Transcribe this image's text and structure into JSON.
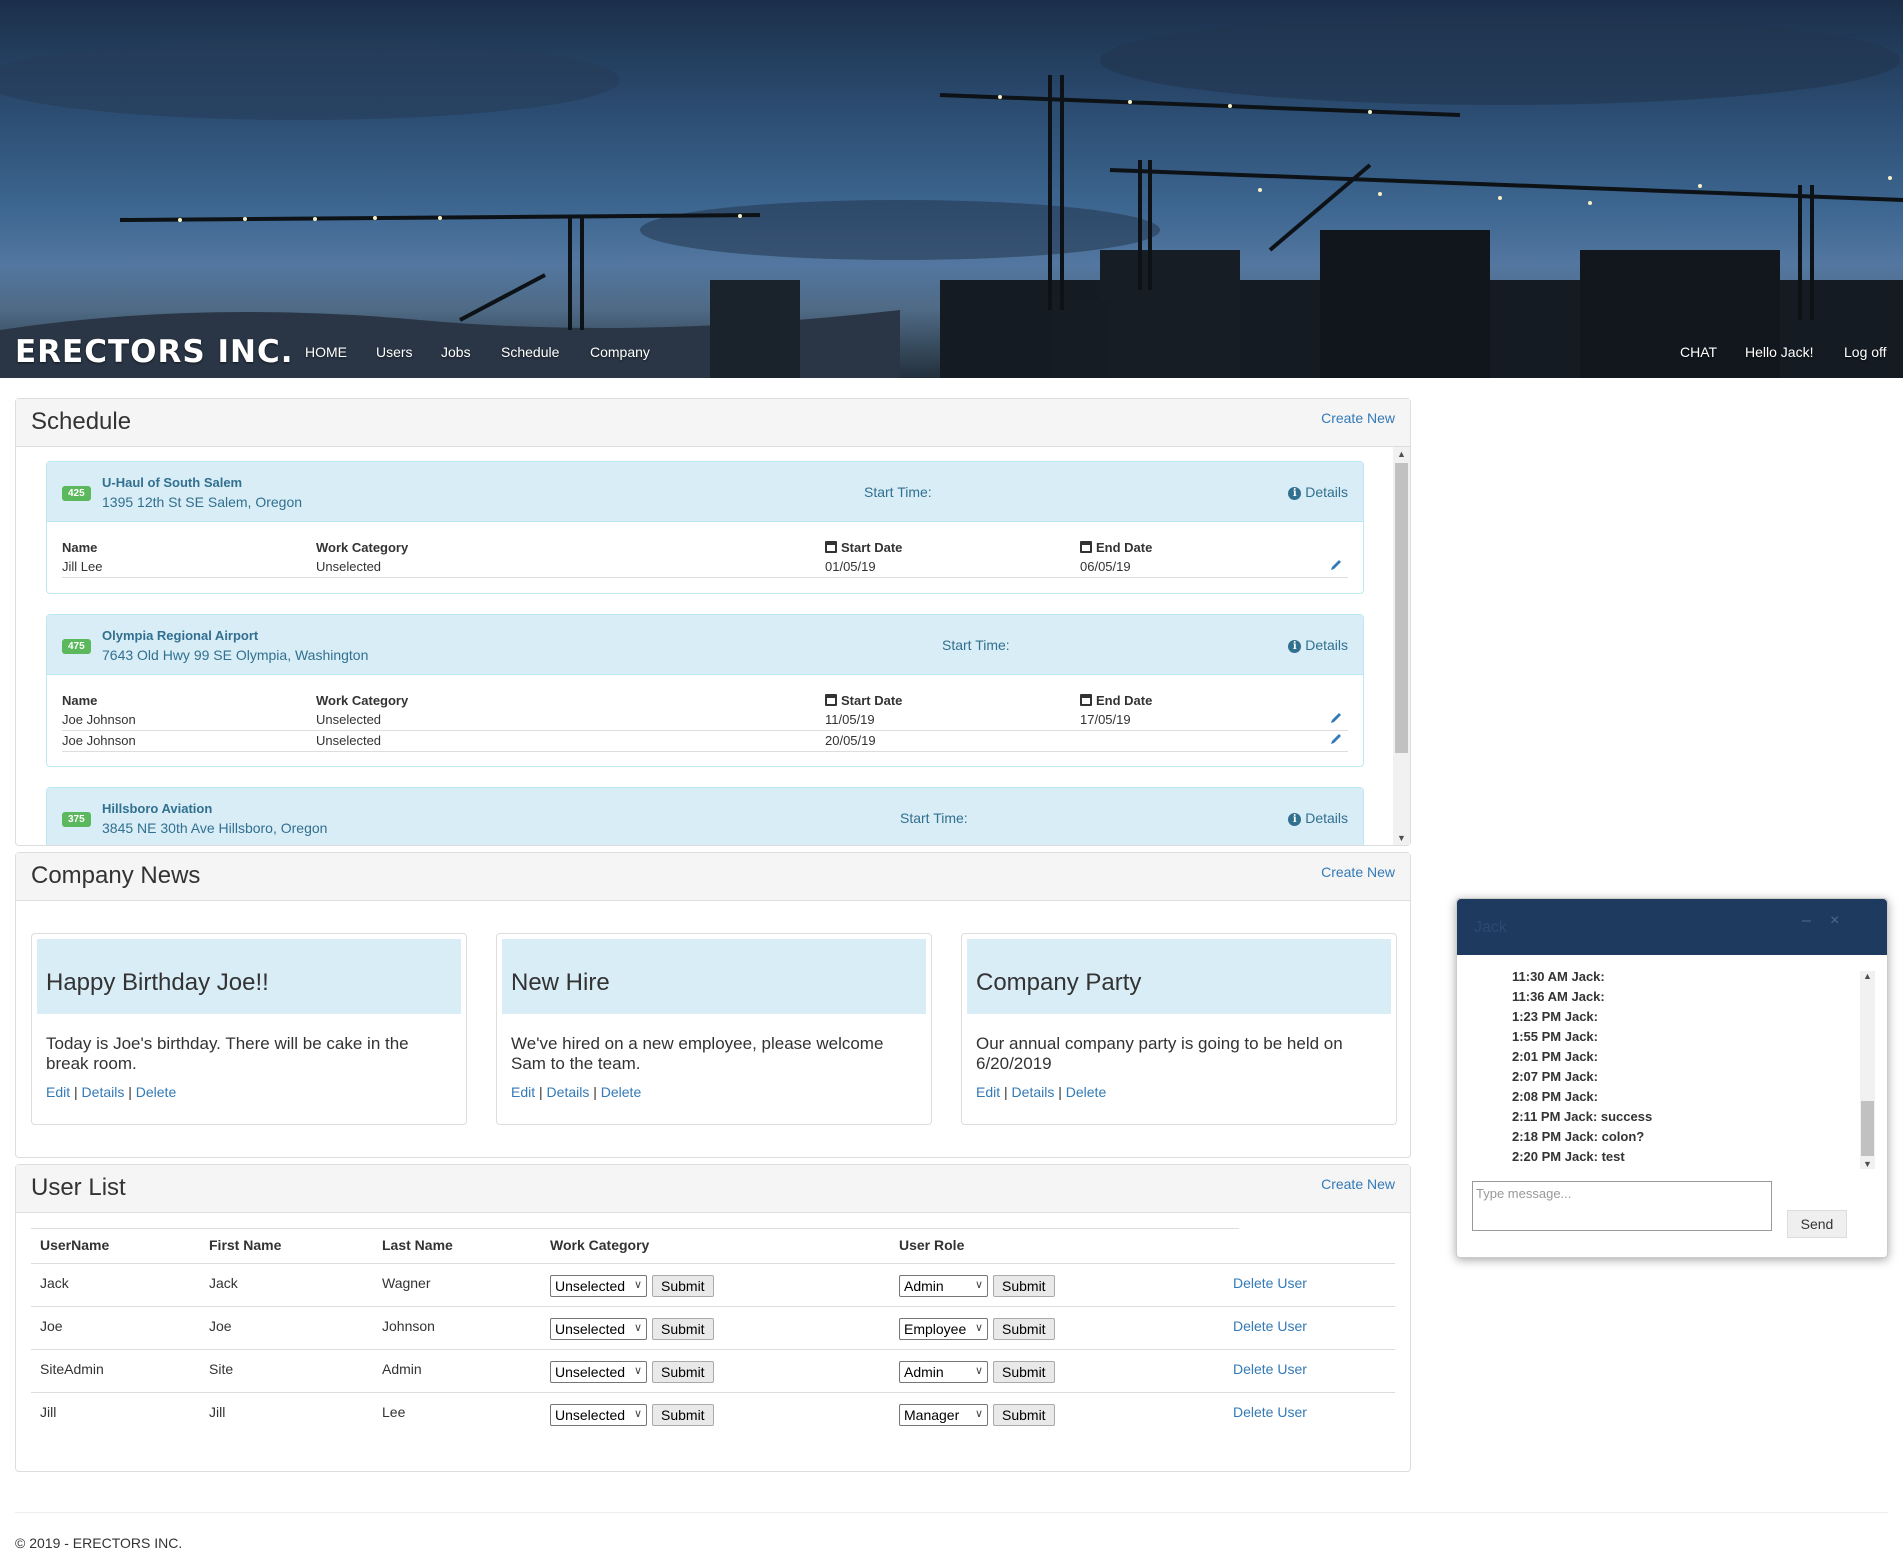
{
  "header": {
    "brand": "ERECTORS INC.",
    "nav": [
      "HOME",
      "Users",
      "Jobs",
      "Schedule",
      "Company"
    ],
    "right_nav": [
      "CHAT",
      "Hello Jack!",
      "Log off"
    ]
  },
  "schedule": {
    "title": "Schedule",
    "create_new": "Create New",
    "start_time_label": "Start Time:",
    "details_label": "Details",
    "columns": {
      "name": "Name",
      "work_category": "Work Category",
      "start_date": "Start Date",
      "end_date": "End Date"
    },
    "jobs": [
      {
        "badge": "425",
        "name": "U-Haul of South Salem",
        "address": "1395 12th St SE Salem, Oregon",
        "rows": [
          {
            "name": "Jill Lee",
            "work_category": "Unselected",
            "start_date": "01/05/19",
            "end_date": "06/05/19"
          }
        ]
      },
      {
        "badge": "475",
        "name": "Olympia Regional Airport",
        "address": "7643 Old Hwy 99 SE Olympia, Washington",
        "rows": [
          {
            "name": "Joe Johnson",
            "work_category": "Unselected",
            "start_date": "11/05/19",
            "end_date": "17/05/19"
          },
          {
            "name": "Joe Johnson",
            "work_category": "Unselected",
            "start_date": "20/05/19",
            "end_date": ""
          }
        ]
      },
      {
        "badge": "375",
        "name": "Hillsboro Aviation",
        "address": "3845 NE 30th Ave Hillsboro, Oregon",
        "rows": []
      }
    ]
  },
  "news": {
    "title": "Company News",
    "create_new": "Create New",
    "links": {
      "edit": "Edit",
      "details": "Details",
      "delete": "Delete",
      "sep": "|"
    },
    "items": [
      {
        "title": "Happy Birthday Joe!!",
        "body": "Today is Joe's birthday. There will be cake in the break room."
      },
      {
        "title": "New Hire",
        "body": "We've hired on a new employee, please welcome Sam to the team."
      },
      {
        "title": "Company Party",
        "body": "Our annual company party is going to be held on 6/20/2019"
      }
    ]
  },
  "users": {
    "title": "User List",
    "create_new": "Create New",
    "columns": [
      "UserName",
      "First Name",
      "Last Name",
      "Work Category",
      "User Role"
    ],
    "submit_label": "Submit",
    "delete_label": "Delete User",
    "rows": [
      {
        "username": "Jack",
        "first": "Jack",
        "last": "Wagner",
        "category": "Unselected",
        "role": "Admin"
      },
      {
        "username": "Joe",
        "first": "Joe",
        "last": "Johnson",
        "category": "Unselected",
        "role": "Employee"
      },
      {
        "username": "SiteAdmin",
        "first": "Site",
        "last": "Admin",
        "category": "Unselected",
        "role": "Admin"
      },
      {
        "username": "Jill",
        "first": "Jill",
        "last": "Lee",
        "category": "Unselected",
        "role": "Manager"
      }
    ]
  },
  "footer": {
    "text": "© 2019 - ERECTORS INC."
  },
  "chat": {
    "title": "Jack",
    "minimize": "–",
    "close": "×",
    "messages": [
      "11:30 AM Jack:",
      "11:36 AM Jack:",
      "1:23 PM Jack:",
      "1:55 PM Jack:",
      "2:01 PM Jack:",
      "2:07 PM Jack:",
      "2:08 PM Jack:",
      "2:11 PM Jack: success",
      "2:18 PM Jack: colon?",
      "2:20 PM Jack: test"
    ],
    "placeholder": "Type message...",
    "send_label": "Send"
  },
  "colors": {
    "accent": "#337ab7",
    "info_bg": "#d9edf7",
    "badge": "#5cb85c",
    "chat_header": "#1f3a5f"
  }
}
